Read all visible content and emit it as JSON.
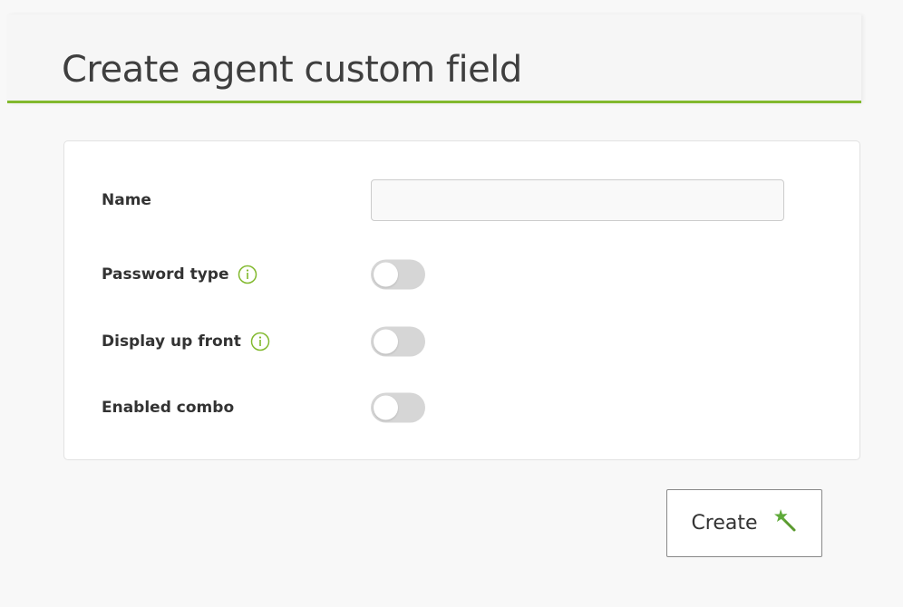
{
  "header": {
    "title": "Create agent custom field"
  },
  "form": {
    "fields": [
      {
        "label": "Name",
        "type": "text",
        "value": "",
        "placeholder": ""
      },
      {
        "label": "Password type",
        "type": "toggle",
        "checked": false,
        "help_icon": "info-icon"
      },
      {
        "label": "Display up front",
        "type": "toggle",
        "checked": false,
        "help_icon": "info-icon"
      },
      {
        "label": "Enabled combo",
        "type": "toggle",
        "checked": false
      }
    ]
  },
  "actions": {
    "create_label": "Create",
    "create_icon": "magic-wand-icon"
  },
  "colors": {
    "accent": "#82b92e",
    "toggle_off": "#d6d6d6"
  }
}
